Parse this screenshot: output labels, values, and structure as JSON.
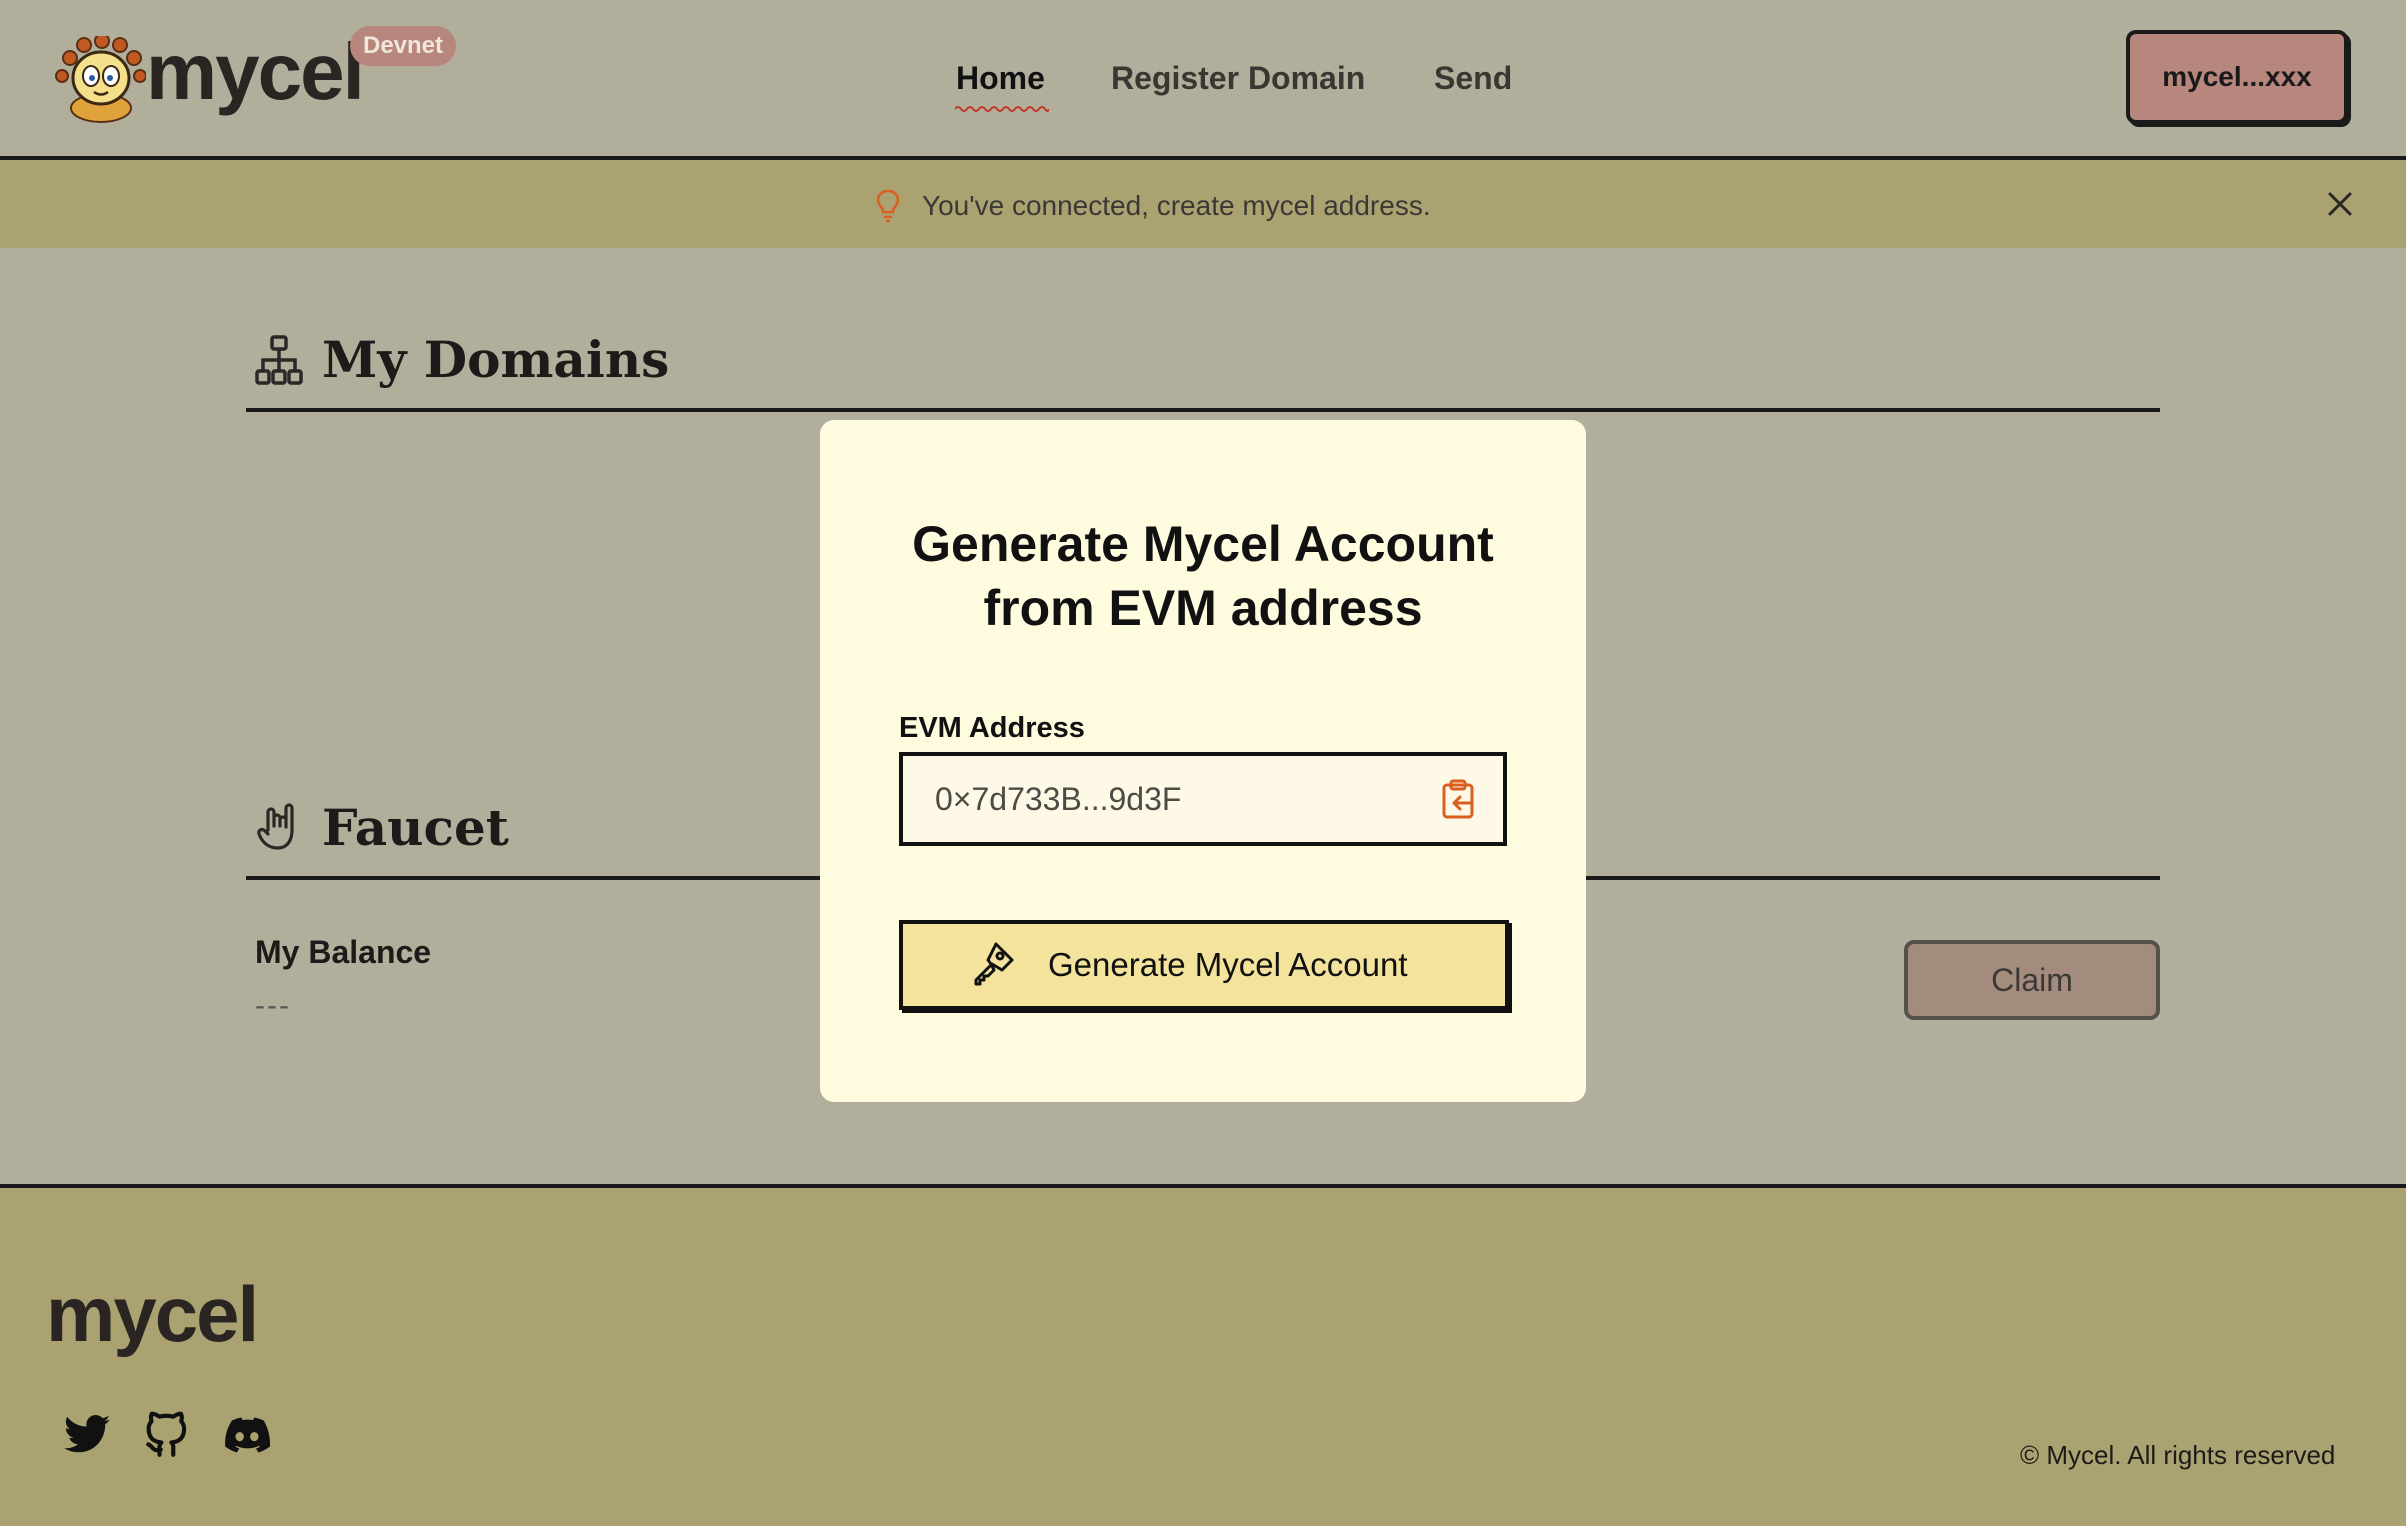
{
  "header": {
    "logo_text": "mycel",
    "network_badge": "Devnet",
    "nav": [
      {
        "label": "Home",
        "active": true
      },
      {
        "label": "Register Domain",
        "active": false
      },
      {
        "label": "Send",
        "active": false
      }
    ],
    "wallet_button": "mycel...xxx"
  },
  "banner": {
    "icon": "lightbulb-icon",
    "text": "You've connected, create mycel address.",
    "close_icon": "close-icon"
  },
  "sections": {
    "domains": {
      "icon": "sitemap-icon",
      "title": "My Domains"
    },
    "faucet": {
      "icon": "hand-icon",
      "title": "Faucet",
      "balance_label": "My Balance",
      "balance_value": "---",
      "claim_button": "Claim"
    }
  },
  "modal": {
    "title_line1": "Generate Mycel Account",
    "title_line2": "from EVM address",
    "field_label": "EVM Address",
    "field_value": "0×7d733B...9d3F",
    "paste_icon": "clipboard-paste-icon",
    "generate_button": "Generate Mycel Account",
    "button_icon": "key-icon"
  },
  "footer": {
    "logo_text": "mycel",
    "social": [
      "twitter-icon",
      "github-icon",
      "discord-icon"
    ],
    "copyright": "© Mycel. All rights reserved"
  },
  "colors": {
    "page_bg": "#b1af9c",
    "banner_bg": "#aaa371",
    "modal_bg": "#fefbdf",
    "accent_orange": "#d9601e",
    "wallet_btn": "#b7867c",
    "generate_btn": "#f3e39c"
  }
}
